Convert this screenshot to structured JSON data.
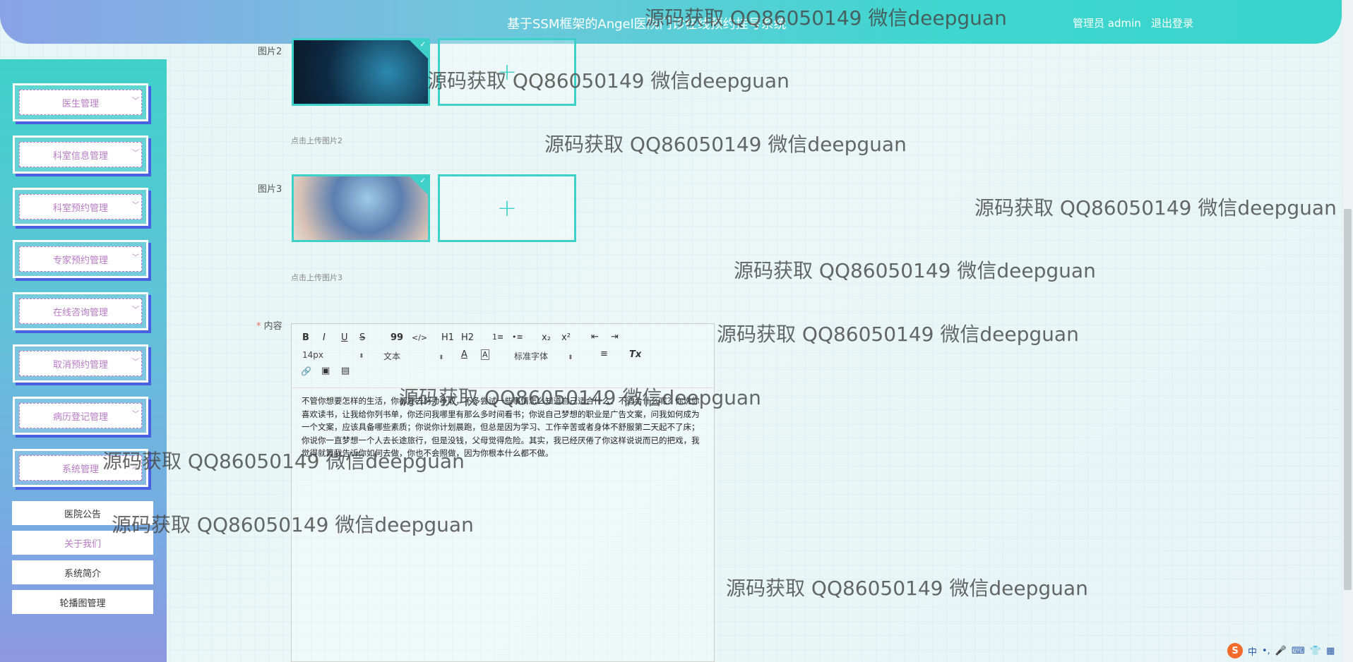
{
  "header": {
    "title": "基于SSM框架的Angel医院门诊在线预约挂号系统",
    "user_label": "管理员 admin",
    "logout_label": "退出登录"
  },
  "sidebar": {
    "menus": [
      {
        "label": "医生管理"
      },
      {
        "label": "科室信息管理"
      },
      {
        "label": "科室预约管理"
      },
      {
        "label": "专家预约管理"
      },
      {
        "label": "在线咨询管理"
      },
      {
        "label": "取消预约管理"
      },
      {
        "label": "病历登记管理"
      },
      {
        "label": "系统管理"
      }
    ],
    "sub_items": [
      {
        "label": "医院公告"
      },
      {
        "label": "关于我们"
      },
      {
        "label": "系统简介"
      },
      {
        "label": "轮播图管理"
      }
    ]
  },
  "form": {
    "image2_label": "图片2",
    "image2_hint": "点击上传图片2",
    "image3_label": "图片3",
    "image3_hint": "点击上传图片3",
    "content_label": "内容",
    "required_mark": "*",
    "upload_plus": "+"
  },
  "editor": {
    "toolbar": {
      "bold": "B",
      "italic": "I",
      "underline": "U",
      "strike": "S",
      "blockquote": "99",
      "code": "</>",
      "h1": "H1",
      "h2": "H2",
      "ordered_list": "1≡",
      "bullet_list": "•≡",
      "subscript": "x₂",
      "superscript": "x²",
      "outdent": "⇤",
      "indent": "⇥",
      "size_select": "14px",
      "type_select": "文本",
      "color": "A",
      "background": "A",
      "font_select": "标准字体",
      "align": "≡",
      "clean": "Tx",
      "link": "🔗",
      "image": "▣",
      "video": "▤"
    },
    "content": "不管你想要怎样的生活，你都要去努力争取，不多尝试一些事情怎么知道自己适合什么、不适合什么呢？你说你喜欢读书，让我给你列书单，你还问我哪里有那么多时间看书；你说自己梦想的职业是广告文案，问我如何成为一个文案，应该具备哪些素质；你说你计划晨跑，但总是因为学习、工作辛苦或者身体不舒服第二天起不了床；你说你一直梦想一个人去长途旅行，但是没钱，父母觉得危险。其实，我已经厌倦了你这样说说而已的把戏，我觉得就算我告诉你如何去做，你也不会照做，因为你根本什么都不做。"
  },
  "watermark_text": "源码获取 QQ86050149 微信deepguan",
  "ime": {
    "logo": "S",
    "lang": "中"
  },
  "colors": {
    "accent": "#3fd1c9",
    "menu_text": "#b87ac6",
    "menu_shadow": "#4961e0"
  }
}
